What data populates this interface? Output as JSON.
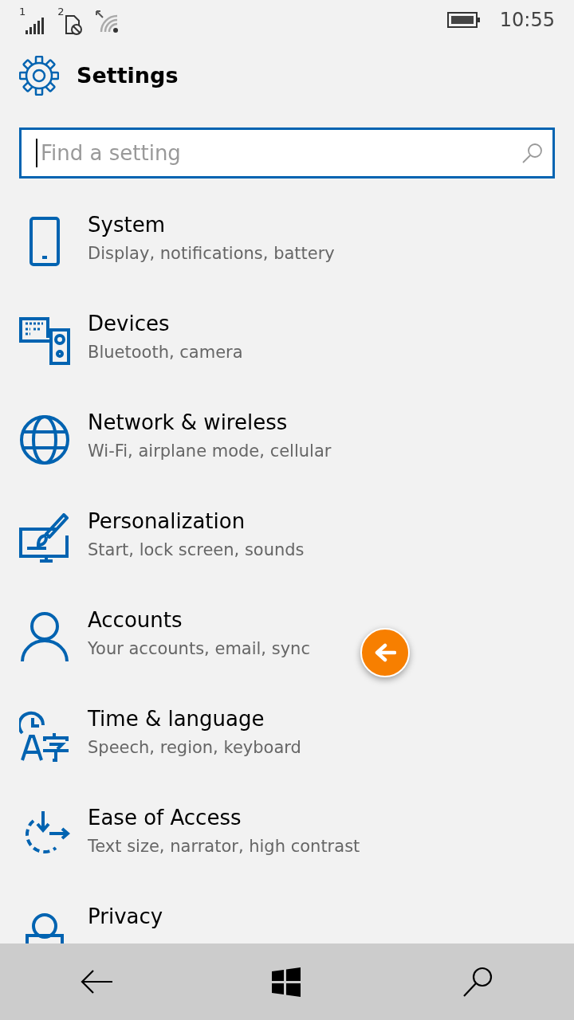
{
  "status_bar": {
    "sim_1": "1",
    "sim_2": "2",
    "time": "10:55"
  },
  "header": {
    "title": "Settings"
  },
  "search": {
    "placeholder": "Find a setting"
  },
  "items": [
    {
      "title": "System",
      "subtitle": "Display, notifications, battery"
    },
    {
      "title": "Devices",
      "subtitle": "Bluetooth, camera"
    },
    {
      "title": "Network & wireless",
      "subtitle": "Wi-Fi, airplane mode, cellular"
    },
    {
      "title": "Personalization",
      "subtitle": "Start, lock screen, sounds"
    },
    {
      "title": "Accounts",
      "subtitle": "Your accounts, email, sync"
    },
    {
      "title": "Time & language",
      "subtitle": "Speech, region, keyboard"
    },
    {
      "title": "Ease of Access",
      "subtitle": "Text size, narrator, high contrast"
    },
    {
      "title": "Privacy"
    }
  ]
}
